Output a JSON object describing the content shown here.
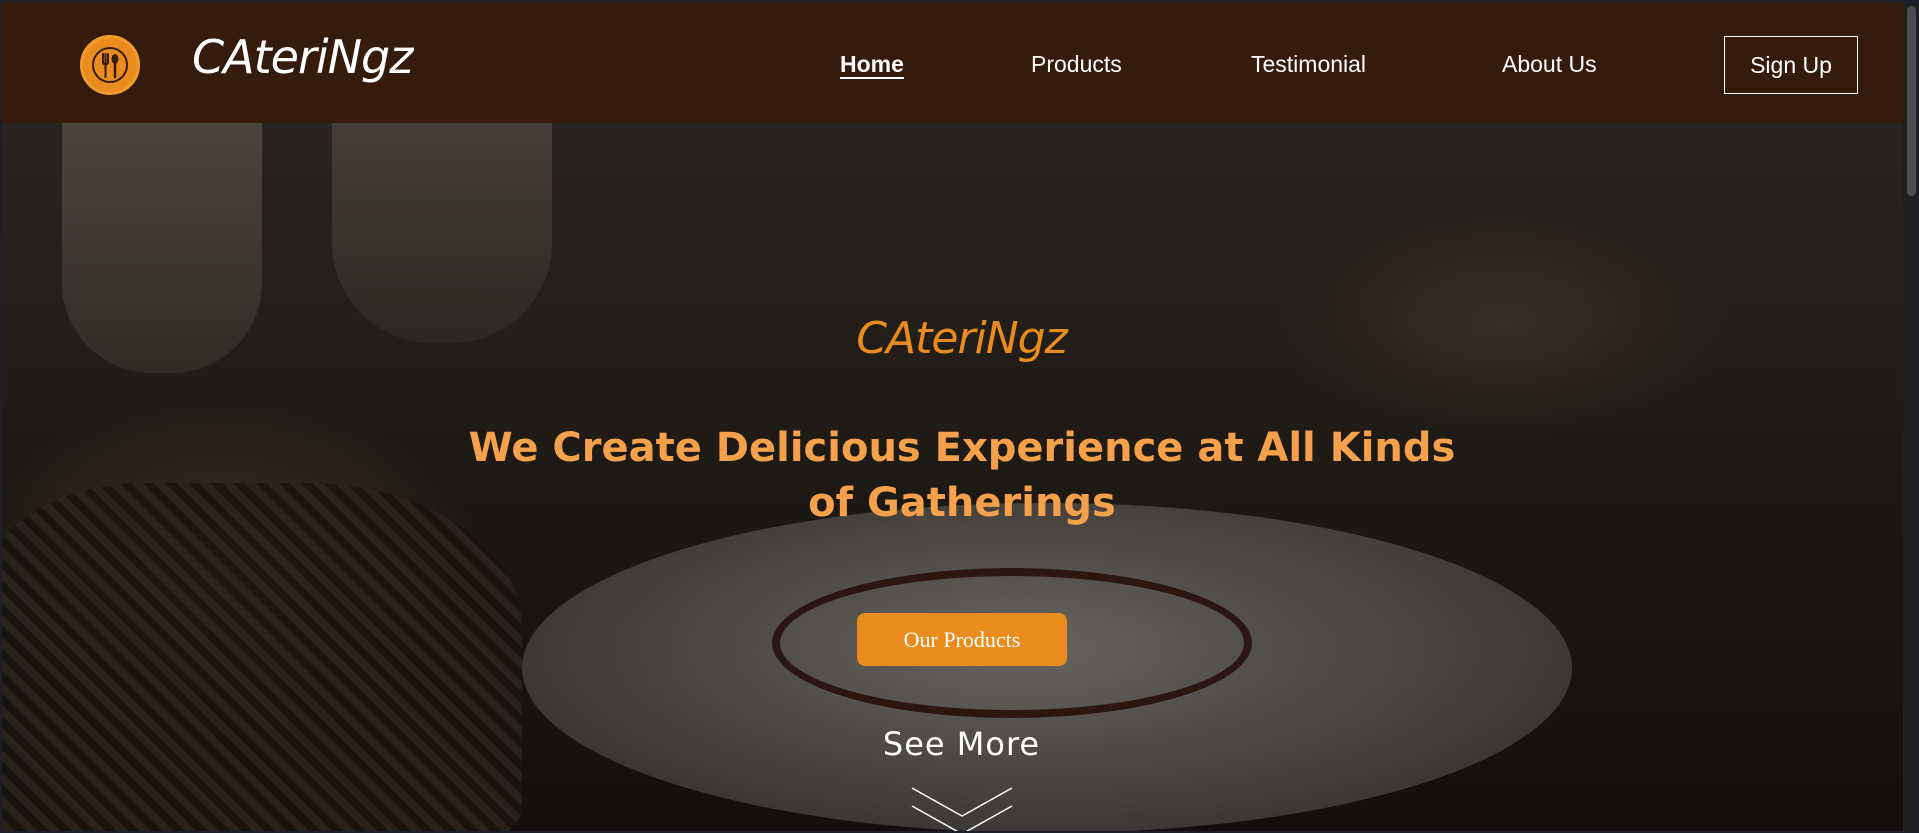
{
  "header": {
    "logo_icon": "fork-spoon-icon",
    "brand": "CAteriNgz",
    "nav": [
      {
        "label": "Home",
        "active": true
      },
      {
        "label": "Products",
        "active": false
      },
      {
        "label": "Testimonial",
        "active": false
      },
      {
        "label": "About Us",
        "active": false
      }
    ],
    "signup_label": "Sign Up"
  },
  "hero": {
    "brand": "CAteriNgz",
    "tagline": "We Create Delicious Experience at All Kinds of Gatherings",
    "cta_label": "Our Products",
    "see_more_label": "See More",
    "see_more_icon": "double-chevron-down-icon"
  },
  "colors": {
    "header_bg": "#351b0b",
    "accent": "#ea8b1d",
    "tagline": "#f5a04a"
  }
}
